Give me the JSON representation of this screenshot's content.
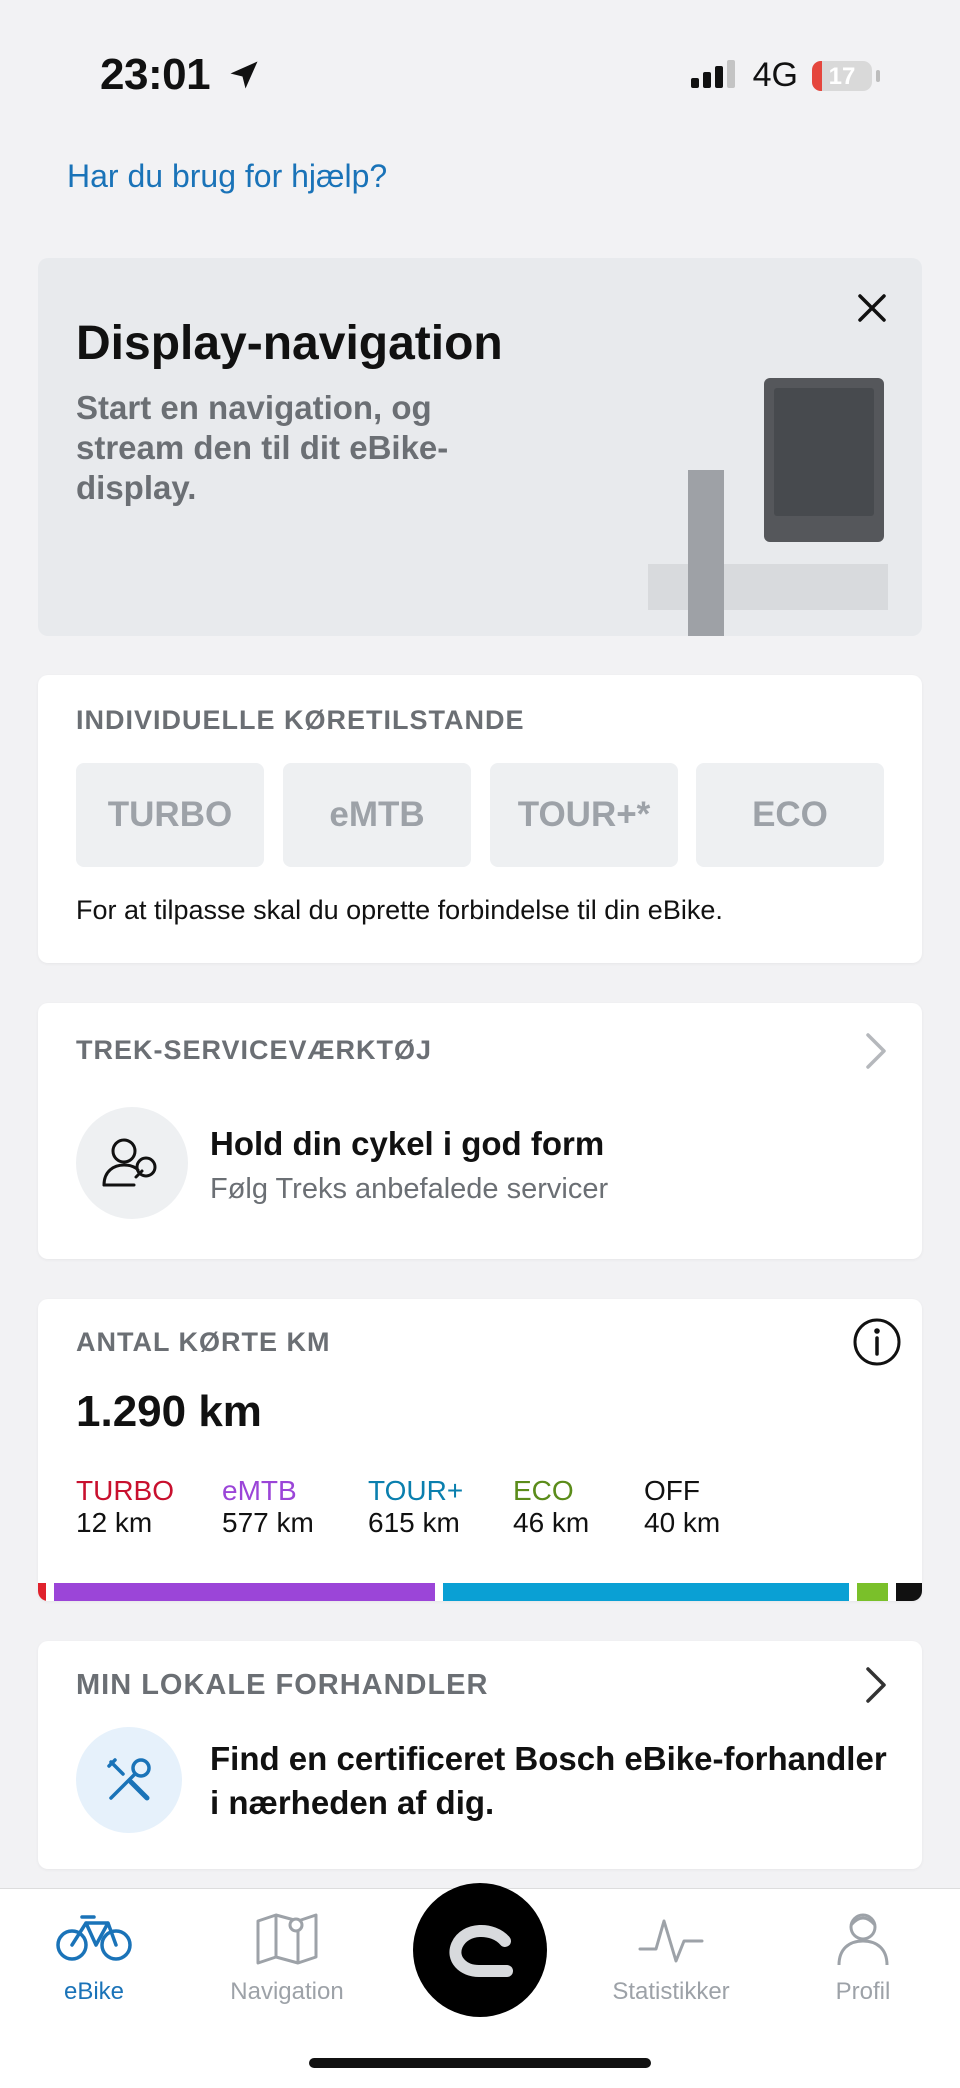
{
  "status_bar": {
    "time": "23:01",
    "network": "4G",
    "battery": "17",
    "battery_level": 0.17
  },
  "help_link": "Har du brug for hjælp?",
  "banner": {
    "title": "Display-navigation",
    "text": "Start en navigation, og stream den til dit eBike-display."
  },
  "modes_card": {
    "title": "INDIVIDUELLE KØRETILSTANDE",
    "modes": [
      "TURBO",
      "eMTB",
      "TOUR+*",
      "ECO"
    ],
    "hint": "For at tilpasse skal du oprette forbindelse til din eBike."
  },
  "service_card": {
    "title": "TREK-SERVICEVÆRKTØJ",
    "heading": "Hold din cykel i god form",
    "subtext": "Følg Treks anbefalede servicer"
  },
  "distance_card": {
    "title": "ANTAL KØRTE KM",
    "total": "1.290 km",
    "stats": [
      {
        "name": "TURBO",
        "value": "12 km",
        "km": 12,
        "color": "#c8102e"
      },
      {
        "name": "eMTB",
        "value": "577 km",
        "km": 577,
        "color": "#9b45d8"
      },
      {
        "name": "TOUR+",
        "value": "615 km",
        "km": 615,
        "color": "#0aa0d4"
      },
      {
        "name": "ECO",
        "value": "46 km",
        "km": 46,
        "color": "#5b8c1a"
      },
      {
        "name": "OFF",
        "value": "40 km",
        "km": 40,
        "color": "#111111"
      }
    ],
    "bar_colors": [
      "#e0222d",
      "#9b45d8",
      "#0aa0d4",
      "#7ac02a",
      "#111111"
    ]
  },
  "dealer_card": {
    "title": "MIN LOKALE FORHANDLER",
    "text_line1": "Find en certificeret Bosch eBike-forhandler",
    "text_line2": "i nærheden af dig."
  },
  "tabbar": {
    "tabs": [
      {
        "label": "eBike",
        "icon": "bike-icon"
      },
      {
        "label": "Navigation",
        "icon": "map-icon"
      },
      {
        "label": "Statistikker",
        "icon": "pulse-icon"
      },
      {
        "label": "Profil",
        "icon": "profile-icon"
      }
    ],
    "active": "eBike"
  }
}
